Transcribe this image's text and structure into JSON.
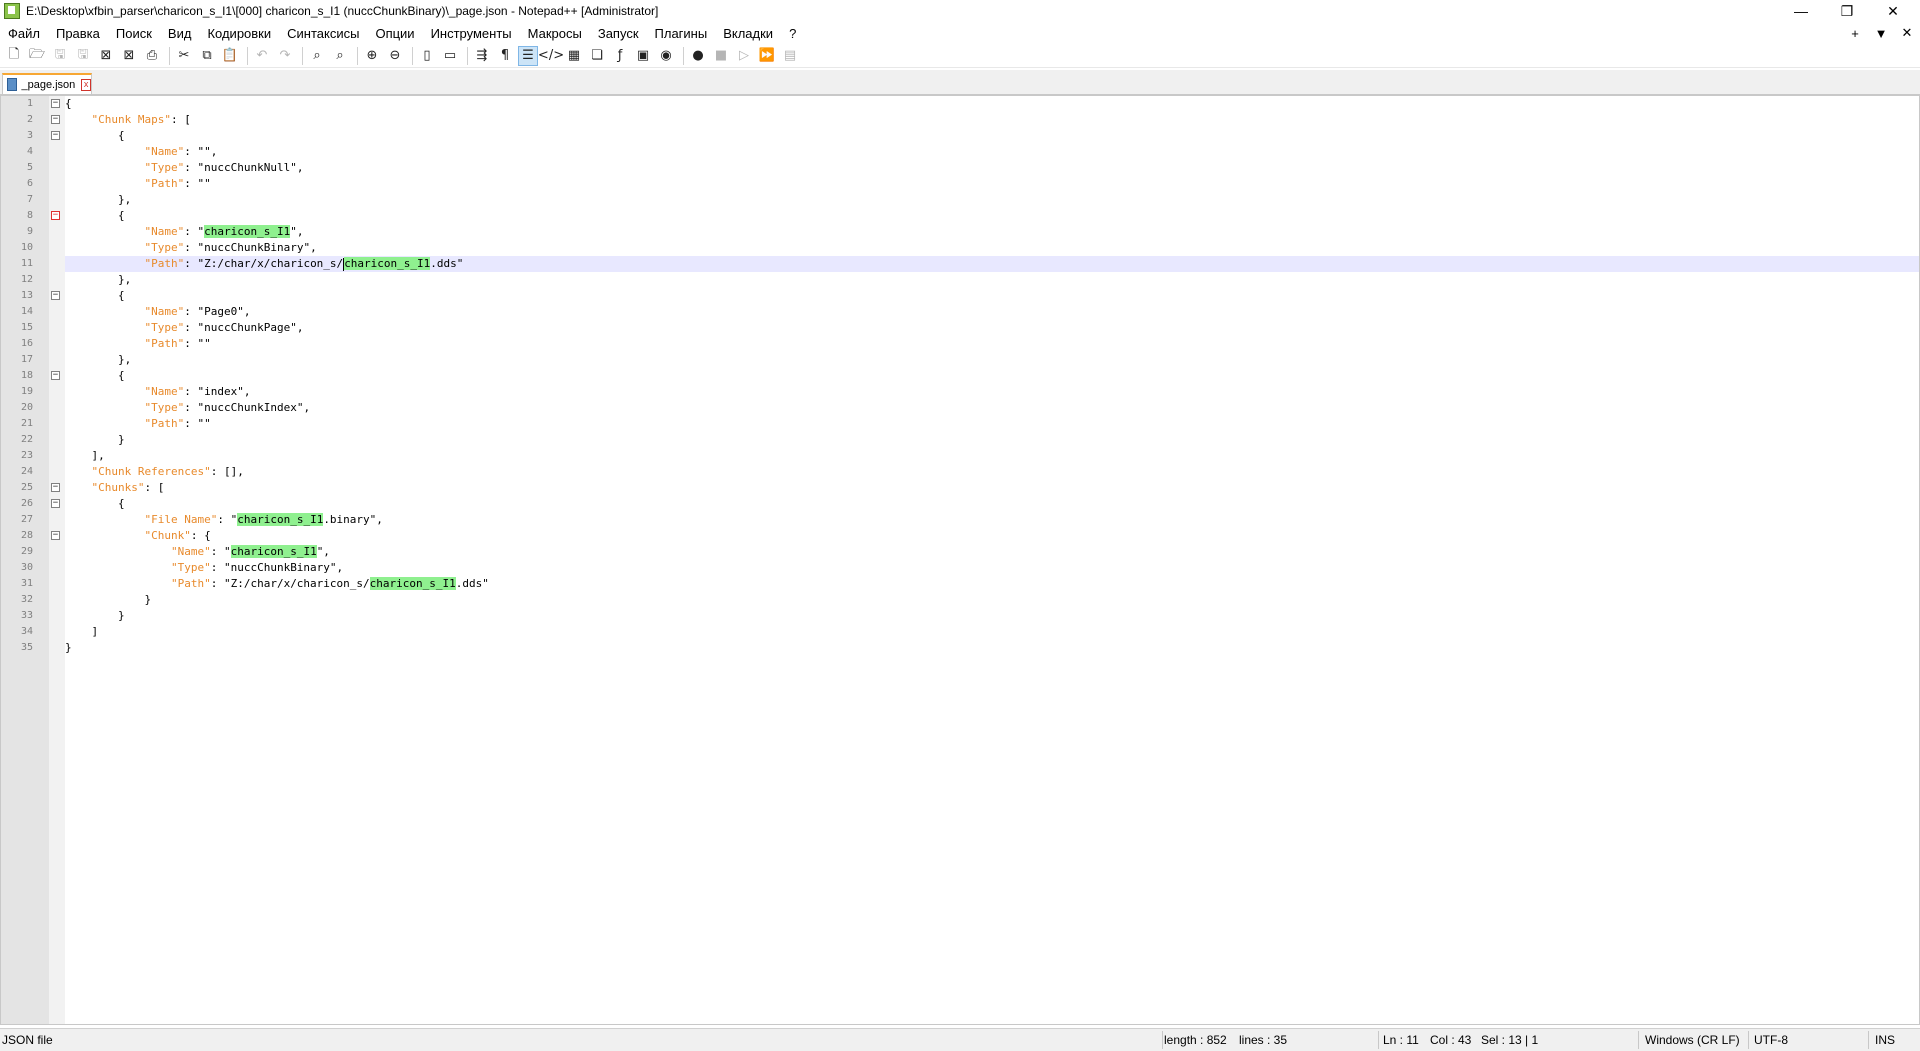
{
  "window": {
    "title": "E:\\Desktop\\xfbin_parser\\charicon_s_I1\\[000] charicon_s_I1 (nuccChunkBinary)\\_page.json - Notepad++ [Administrator]",
    "minimize": "—",
    "restore": "❐",
    "close": "✕"
  },
  "menu": {
    "items": [
      "Файл",
      "Правка",
      "Поиск",
      "Вид",
      "Кодировки",
      "Синтаксисы",
      "Опции",
      "Инструменты",
      "Макросы",
      "Запуск",
      "Плагины",
      "Вкладки",
      "?"
    ],
    "right_add": "+",
    "right_dropdown": "▼",
    "right_close": "✕"
  },
  "toolbar": {
    "buttons": [
      {
        "name": "new-file-icon",
        "glyph": "🗋"
      },
      {
        "name": "open-file-icon",
        "glyph": "🗁"
      },
      {
        "name": "save-icon",
        "glyph": "🖫",
        "dim": true
      },
      {
        "name": "save-all-icon",
        "glyph": "🖫",
        "dim": true
      },
      {
        "name": "close-icon",
        "glyph": "⊠"
      },
      {
        "name": "close-all-icon",
        "glyph": "⊠"
      },
      {
        "name": "print-icon",
        "glyph": "⎙"
      },
      {
        "sep": true
      },
      {
        "name": "cut-icon",
        "glyph": "✂"
      },
      {
        "name": "copy-icon",
        "glyph": "⧉"
      },
      {
        "name": "paste-icon",
        "glyph": "📋"
      },
      {
        "sep": true
      },
      {
        "name": "undo-icon",
        "glyph": "↶",
        "dim": true
      },
      {
        "name": "redo-icon",
        "glyph": "↷",
        "dim": true
      },
      {
        "sep": true
      },
      {
        "name": "find-icon",
        "glyph": "⌕"
      },
      {
        "name": "replace-icon",
        "glyph": "⌕"
      },
      {
        "sep": true
      },
      {
        "name": "zoom-in-icon",
        "glyph": "⊕"
      },
      {
        "name": "zoom-out-icon",
        "glyph": "⊖"
      },
      {
        "sep": true
      },
      {
        "name": "sync-vertical-icon",
        "glyph": "▯"
      },
      {
        "name": "sync-horizontal-icon",
        "glyph": "▭"
      },
      {
        "sep": true
      },
      {
        "name": "word-wrap-icon",
        "glyph": "⇶"
      },
      {
        "name": "show-all-chars-icon",
        "glyph": "¶"
      },
      {
        "name": "indent-guide-icon",
        "glyph": "☰",
        "active": true
      },
      {
        "name": "xml-tag-icon",
        "glyph": "</>"
      },
      {
        "name": "document-map-icon",
        "glyph": "▦"
      },
      {
        "name": "document-list-icon",
        "glyph": "❏"
      },
      {
        "name": "function-list-icon",
        "glyph": "ƒ"
      },
      {
        "name": "folder-as-workspace-icon",
        "glyph": "▣"
      },
      {
        "name": "monitoring-icon",
        "glyph": "◉"
      },
      {
        "sep": true
      },
      {
        "name": "record-macro-icon",
        "glyph": "●"
      },
      {
        "name": "stop-recording-icon",
        "glyph": "■",
        "dim": true
      },
      {
        "name": "play-macro-icon",
        "glyph": "▷",
        "dim": true
      },
      {
        "name": "run-macro-multiple-icon",
        "glyph": "⏩"
      },
      {
        "name": "save-macro-icon",
        "glyph": "▤",
        "dim": true
      }
    ]
  },
  "tab": {
    "label": "_page.json",
    "close": "x"
  },
  "editor": {
    "current_line": 11,
    "lines": [
      {
        "n": "1",
        "fold": "box",
        "code": [
          {
            "t": "{",
            "c": "s"
          }
        ]
      },
      {
        "n": "2",
        "fold": "box",
        "code": [
          {
            "t": "    ",
            "c": "s"
          },
          {
            "t": "\"Chunk Maps\"",
            "c": "k"
          },
          {
            "t": ": [",
            "c": "s"
          }
        ]
      },
      {
        "n": "3",
        "fold": "box",
        "code": [
          {
            "t": "        {",
            "c": "s"
          }
        ]
      },
      {
        "n": "4",
        "fold": "",
        "code": [
          {
            "t": "            ",
            "c": "s"
          },
          {
            "t": "\"Name\"",
            "c": "k"
          },
          {
            "t": ": \"\",",
            "c": "s"
          }
        ]
      },
      {
        "n": "5",
        "fold": "",
        "code": [
          {
            "t": "            ",
            "c": "s"
          },
          {
            "t": "\"Type\"",
            "c": "k"
          },
          {
            "t": ": \"nuccChunkNull\",",
            "c": "s"
          }
        ]
      },
      {
        "n": "6",
        "fold": "",
        "code": [
          {
            "t": "            ",
            "c": "s"
          },
          {
            "t": "\"Path\"",
            "c": "k"
          },
          {
            "t": ": \"\"",
            "c": "s"
          }
        ]
      },
      {
        "n": "7",
        "fold": "",
        "code": [
          {
            "t": "        },",
            "c": "s"
          }
        ]
      },
      {
        "n": "8",
        "fold": "red",
        "code": [
          {
            "t": "        {",
            "c": "s"
          }
        ]
      },
      {
        "n": "9",
        "fold": "",
        "code": [
          {
            "t": "            ",
            "c": "s"
          },
          {
            "t": "\"Name\"",
            "c": "k"
          },
          {
            "t": ": \"",
            "c": "s"
          },
          {
            "t": "charicon_s_I1",
            "c": "hl"
          },
          {
            "t": "\",",
            "c": "s"
          }
        ]
      },
      {
        "n": "10",
        "fold": "",
        "code": [
          {
            "t": "            ",
            "c": "s"
          },
          {
            "t": "\"Type\"",
            "c": "k"
          },
          {
            "t": ": \"nuccChunkBinary\",",
            "c": "s"
          }
        ]
      },
      {
        "n": "11",
        "fold": "",
        "code": [
          {
            "t": "            ",
            "c": "s"
          },
          {
            "t": "\"Path\"",
            "c": "k"
          },
          {
            "t": ": \"Z:/char/x/charicon_s/",
            "c": "s"
          },
          {
            "t": "|",
            "c": "caret"
          },
          {
            "t": "charicon_s_I1",
            "c": "hl"
          },
          {
            "t": ".dds\"",
            "c": "s"
          }
        ]
      },
      {
        "n": "12",
        "fold": "",
        "code": [
          {
            "t": "        },",
            "c": "s"
          }
        ]
      },
      {
        "n": "13",
        "fold": "box",
        "code": [
          {
            "t": "        {",
            "c": "s"
          }
        ]
      },
      {
        "n": "14",
        "fold": "",
        "code": [
          {
            "t": "            ",
            "c": "s"
          },
          {
            "t": "\"Name\"",
            "c": "k"
          },
          {
            "t": ": \"Page0\",",
            "c": "s"
          }
        ]
      },
      {
        "n": "15",
        "fold": "",
        "code": [
          {
            "t": "            ",
            "c": "s"
          },
          {
            "t": "\"Type\"",
            "c": "k"
          },
          {
            "t": ": \"nuccChunkPage\",",
            "c": "s"
          }
        ]
      },
      {
        "n": "16",
        "fold": "",
        "code": [
          {
            "t": "            ",
            "c": "s"
          },
          {
            "t": "\"Path\"",
            "c": "k"
          },
          {
            "t": ": \"\"",
            "c": "s"
          }
        ]
      },
      {
        "n": "17",
        "fold": "",
        "code": [
          {
            "t": "        },",
            "c": "s"
          }
        ]
      },
      {
        "n": "18",
        "fold": "box",
        "code": [
          {
            "t": "        {",
            "c": "s"
          }
        ]
      },
      {
        "n": "19",
        "fold": "",
        "code": [
          {
            "t": "            ",
            "c": "s"
          },
          {
            "t": "\"Name\"",
            "c": "k"
          },
          {
            "t": ": \"index\",",
            "c": "s"
          }
        ]
      },
      {
        "n": "20",
        "fold": "",
        "code": [
          {
            "t": "            ",
            "c": "s"
          },
          {
            "t": "\"Type\"",
            "c": "k"
          },
          {
            "t": ": \"nuccChunkIndex\",",
            "c": "s"
          }
        ]
      },
      {
        "n": "21",
        "fold": "",
        "code": [
          {
            "t": "            ",
            "c": "s"
          },
          {
            "t": "\"Path\"",
            "c": "k"
          },
          {
            "t": ": \"\"",
            "c": "s"
          }
        ]
      },
      {
        "n": "22",
        "fold": "",
        "code": [
          {
            "t": "        }",
            "c": "s"
          }
        ]
      },
      {
        "n": "23",
        "fold": "",
        "code": [
          {
            "t": "    ],",
            "c": "s"
          }
        ]
      },
      {
        "n": "24",
        "fold": "",
        "code": [
          {
            "t": "    ",
            "c": "s"
          },
          {
            "t": "\"Chunk References\"",
            "c": "k"
          },
          {
            "t": ": [],",
            "c": "s"
          }
        ]
      },
      {
        "n": "25",
        "fold": "box",
        "code": [
          {
            "t": "    ",
            "c": "s"
          },
          {
            "t": "\"Chunks\"",
            "c": "k"
          },
          {
            "t": ": [",
            "c": "s"
          }
        ]
      },
      {
        "n": "26",
        "fold": "box",
        "code": [
          {
            "t": "        {",
            "c": "s"
          }
        ]
      },
      {
        "n": "27",
        "fold": "",
        "code": [
          {
            "t": "            ",
            "c": "s"
          },
          {
            "t": "\"File Name\"",
            "c": "k"
          },
          {
            "t": ": \"",
            "c": "s"
          },
          {
            "t": "charicon_s_I1",
            "c": "hl"
          },
          {
            "t": ".binary\",",
            "c": "s"
          }
        ]
      },
      {
        "n": "28",
        "fold": "box",
        "code": [
          {
            "t": "            ",
            "c": "s"
          },
          {
            "t": "\"Chunk\"",
            "c": "k"
          },
          {
            "t": ": {",
            "c": "s"
          }
        ]
      },
      {
        "n": "29",
        "fold": "",
        "code": [
          {
            "t": "                ",
            "c": "s"
          },
          {
            "t": "\"Name\"",
            "c": "k"
          },
          {
            "t": ": \"",
            "c": "s"
          },
          {
            "t": "charicon_s_I1",
            "c": "hl"
          },
          {
            "t": "\",",
            "c": "s"
          }
        ]
      },
      {
        "n": "30",
        "fold": "",
        "code": [
          {
            "t": "                ",
            "c": "s"
          },
          {
            "t": "\"Type\"",
            "c": "k"
          },
          {
            "t": ": \"nuccChunkBinary\",",
            "c": "s"
          }
        ]
      },
      {
        "n": "31",
        "fold": "",
        "code": [
          {
            "t": "                ",
            "c": "s"
          },
          {
            "t": "\"Path\"",
            "c": "k"
          },
          {
            "t": ": \"Z:/char/x/charicon_s/",
            "c": "s"
          },
          {
            "t": "charicon_s_I1",
            "c": "hl"
          },
          {
            "t": ".dds\"",
            "c": "s"
          }
        ]
      },
      {
        "n": "32",
        "fold": "",
        "code": [
          {
            "t": "            }",
            "c": "s"
          }
        ]
      },
      {
        "n": "33",
        "fold": "",
        "code": [
          {
            "t": "        }",
            "c": "s"
          }
        ]
      },
      {
        "n": "34",
        "fold": "",
        "code": [
          {
            "t": "    ]",
            "c": "s"
          }
        ]
      },
      {
        "n": "35",
        "fold": "",
        "code": [
          {
            "t": "}",
            "c": "s"
          }
        ]
      }
    ]
  },
  "status": {
    "filetype": "JSON file",
    "length": "length : 852",
    "lines": "lines : 35",
    "ln": "Ln : 11",
    "col": "Col : 43",
    "sel": "Sel : 13 | 1",
    "eol": "Windows (CR LF)",
    "encoding": "UTF-8",
    "mode": "INS"
  }
}
